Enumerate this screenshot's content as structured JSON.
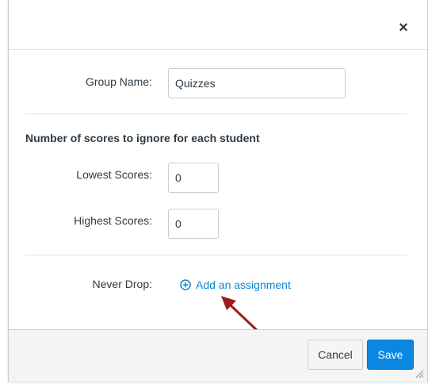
{
  "dialog": {
    "close_glyph": "×"
  },
  "form": {
    "group_name_label": "Group Name:",
    "group_name_value": "Quizzes",
    "scores_heading": "Number of scores to ignore for each student",
    "lowest_label": "Lowest Scores:",
    "lowest_value": "0",
    "highest_label": "Highest Scores:",
    "highest_value": "0",
    "never_drop_label": "Never Drop:",
    "add_assignment_label": "Add an assignment"
  },
  "footer": {
    "cancel_label": "Cancel",
    "save_label": "Save"
  },
  "colors": {
    "link": "#0b87d6",
    "primary": "#0b87e2",
    "annotation_arrow": "#9b1c1c"
  },
  "icons": {
    "close": "close-icon",
    "add": "plus-circle-icon",
    "resize": "resize-grip-icon",
    "annotation": "annotation-arrow-icon"
  }
}
